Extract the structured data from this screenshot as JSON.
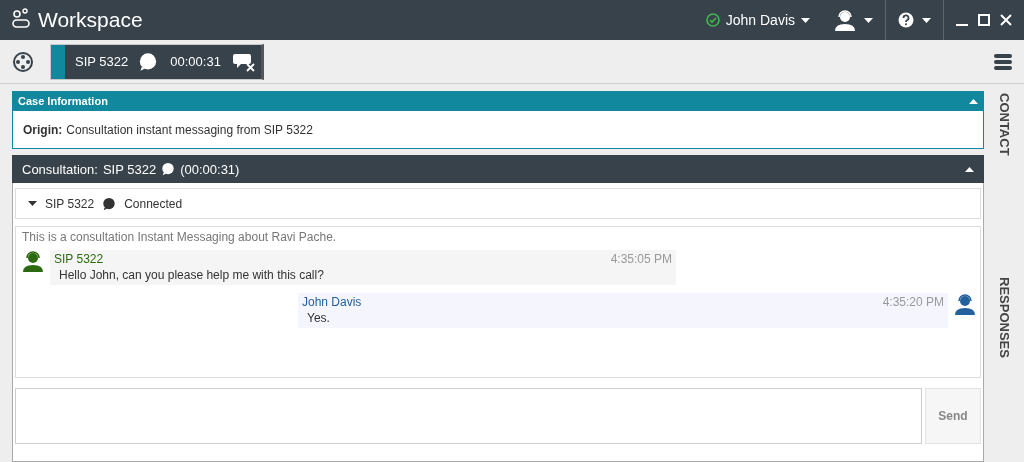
{
  "window": {
    "title": "Workspace"
  },
  "top_bar": {
    "user": "John Davis",
    "available": true
  },
  "interaction_tab": {
    "name": "SIP 5322",
    "timer": "00:00:31",
    "selected": true
  },
  "case_information": {
    "title": "Case Information",
    "expanded": true,
    "origin_label": "Origin:",
    "origin": "Consultation instant messaging from SIP 5322"
  },
  "consultation": {
    "title": "Consultation:",
    "party": "SIP 5322",
    "timer": "(00:00:31)",
    "expanded": true,
    "participant": {
      "name": "SIP 5322",
      "state": "Connected",
      "expanded": true
    },
    "intro": "This is a consultation Instant Messaging about Ravi Pache.",
    "messages": [
      {
        "kind": "remote",
        "sender": "SIP 5322",
        "time": "4:35:05 PM",
        "text": "Hello John, can you please help me with this call?"
      },
      {
        "kind": "self",
        "sender": "John Davis",
        "time": "4:35:20 PM",
        "text": "Yes."
      }
    ],
    "send_button": {
      "label": "Send",
      "disabled": true
    }
  },
  "side_tabs": [
    "CONTACT",
    "RESPONSES"
  ]
}
